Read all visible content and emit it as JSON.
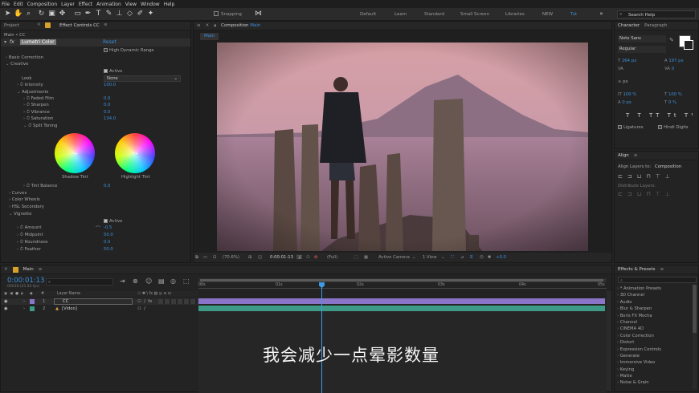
{
  "menu": [
    "File",
    "Edit",
    "Composition",
    "Layer",
    "Effect",
    "Animation",
    "View",
    "Window",
    "Help"
  ],
  "toolbar": {
    "snapping": "Snapping",
    "workspaces": [
      "Default",
      "Learn",
      "Standard",
      "Small Screen",
      "Libraries",
      "NEW",
      "Tut"
    ],
    "search": "Search Help"
  },
  "left_panel": {
    "tabs": [
      "Project",
      "Effect Controls CC"
    ],
    "breadcrumb": "Main • CC",
    "effect_name": "Lumetri Color",
    "reset": "Reset",
    "hdr": "High Dynamic Range",
    "sections": {
      "basic": "Basic Correction",
      "creative": "Creative",
      "active": "Active",
      "look": "Look",
      "look_value": "None",
      "intensity": "Intensity",
      "intensity_val": "100.0",
      "adjustments": "Adjustments",
      "faded_film": "Faded Film",
      "faded_film_val": "0.0",
      "sharpen": "Sharpen",
      "sharpen_val": "0.0",
      "vibrance": "Vibrance",
      "vibrance_val": "0.0",
      "saturation": "Saturation",
      "saturation_val": "134.0",
      "split_toning": "Split Toning",
      "shadow_tint": "Shadow Tint",
      "highlight_tint": "Highlight Tint",
      "tint_balance": "Tint Balance",
      "tint_balance_val": "0.0",
      "curves": "Curves",
      "color_wheels": "Color Wheels",
      "hsl": "HSL Secondary",
      "vignette": "Vignette",
      "v_active": "Active",
      "amount": "Amount",
      "amount_val": "-0.5",
      "midpoint": "Midpoint",
      "midpoint_val": "50.0",
      "roundness": "Roundness",
      "roundness_val": "0.0",
      "feather": "Feather",
      "feather_val": "50.0"
    }
  },
  "composition": {
    "tab_label": "Composition",
    "tab_name": "Main",
    "comp_tab": "Main",
    "footer": {
      "zoom": "(70.6%)",
      "timecode": "0:00:01:13",
      "resolution": "(Full)",
      "camera": "Active Camera",
      "view": "1 View",
      "exposure": "+0.0"
    }
  },
  "character": {
    "tabs": [
      "Character",
      "Paragraph"
    ],
    "font": "Noto Sans",
    "style": "Regular",
    "size": "264 px",
    "leading": "197 px",
    "kerning": "",
    "tracking": "0",
    "stroke": "px",
    "vscale": "100 %",
    "hscale": "100 %",
    "baseline": "0 px",
    "tsume": "0 %",
    "ligatures": "Ligatures",
    "hindi": "Hindi Digits"
  },
  "align": {
    "title": "Align",
    "align_to_label": "Align Layers to:",
    "align_to": "Composition",
    "distribute": "Distribute Layers:"
  },
  "effects": {
    "title": "Effects & Presets",
    "items": [
      "* Animation Presets",
      "3D Channel",
      "Audio",
      "Blur & Sharpen",
      "Boris FX Mocha",
      "Channel",
      "CINEMA 4D",
      "Color Correction",
      "Distort",
      "Expression Controls",
      "Generate",
      "Immersive Video",
      "Keying",
      "Matte",
      "Noise & Grain"
    ]
  },
  "timeline": {
    "tab": "Main",
    "timecode": "0:00:01:13",
    "fps": "00038 (25.00 fps)",
    "layer_header": "Layer Name",
    "layers": [
      {
        "num": "1",
        "name": "CC"
      },
      {
        "num": "2",
        "name": "[Video]"
      }
    ],
    "ticks": [
      "00s",
      "01s",
      "02s",
      "03s",
      "04s",
      "05s"
    ],
    "subtitle": "我会减少一点晕影数量"
  },
  "colors": {
    "accent": "#3b8fd9",
    "playhead": "#3d9ae8",
    "adj_layer": "#8a75c9",
    "video_layer": "#3c9a86"
  }
}
